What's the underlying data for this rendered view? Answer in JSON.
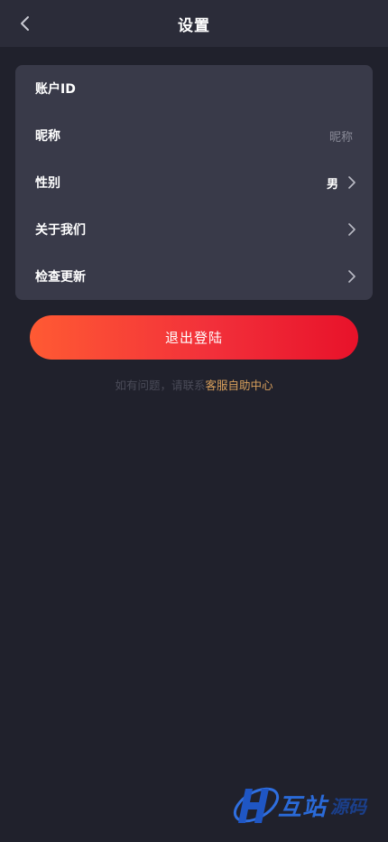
{
  "header": {
    "title": "设置",
    "back_icon": "chevron-left-icon"
  },
  "settings": {
    "rows": [
      {
        "label": "账户ID",
        "value": ""
      },
      {
        "label": "昵称",
        "value": "昵称"
      },
      {
        "label": "性别",
        "value": "男"
      },
      {
        "label": "关于我们",
        "value": ""
      },
      {
        "label": "检查更新",
        "value": ""
      }
    ]
  },
  "logout": {
    "label": "退出登陆"
  },
  "help": {
    "text": "如有问题，请联系",
    "link": "客服自助中心"
  },
  "watermark": {
    "text": "互站",
    "sub": "源码"
  },
  "colors": {
    "background": "#20212c",
    "header": "#2b2c39",
    "card": "#393a49",
    "button_start": "#ff5a33",
    "button_end": "#e8122a",
    "link": "#d9a05c"
  }
}
